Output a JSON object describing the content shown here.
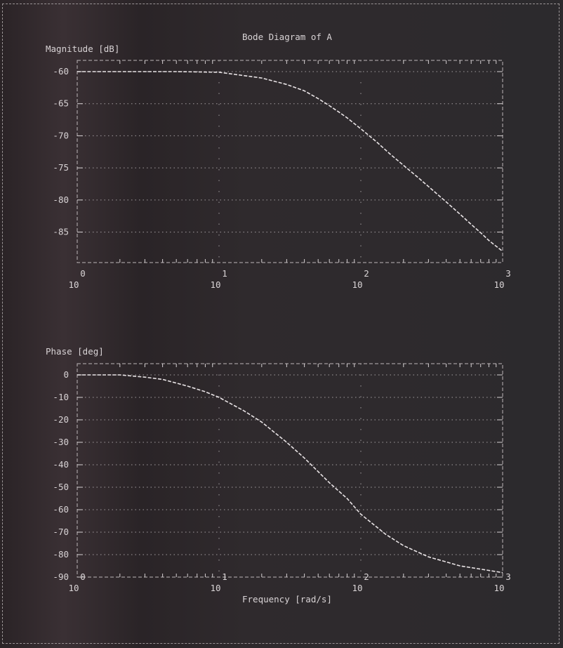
{
  "window": {
    "title": "Bode Diagram of A"
  },
  "chart_data": [
    {
      "type": "line",
      "title": "Bode Diagram of A",
      "ylabel": "Magnitude [dB]",
      "xlabel": "",
      "xscale": "log",
      "xlim": [
        1,
        1000
      ],
      "ylim": [
        -88,
        -60
      ],
      "yticks": [
        -60,
        -65,
        -70,
        -75,
        -80,
        -85
      ],
      "xticks": [
        1,
        10,
        100,
        1000
      ],
      "xtick_labels": [
        {
          "base": "10",
          "exp": "0"
        },
        {
          "base": "10",
          "exp": "1"
        },
        {
          "base": "10",
          "exp": "2"
        },
        {
          "base": "10",
          "exp": "3"
        }
      ],
      "grid": true,
      "series": [
        {
          "x": [
            1,
            2,
            5,
            10,
            20,
            30,
            40,
            50,
            60,
            70,
            80,
            100,
            130,
            160,
            200,
            250,
            300,
            400,
            500,
            600,
            700,
            800,
            1000
          ],
          "values": [
            -60,
            -60,
            -60,
            -60.1,
            -61,
            -62,
            -63,
            -64.2,
            -65.3,
            -66.3,
            -67.2,
            -68.9,
            -71,
            -72.8,
            -74.6,
            -76.4,
            -77.9,
            -80.3,
            -82.2,
            -83.8,
            -85.1,
            -86.3,
            -88
          ]
        }
      ]
    },
    {
      "type": "line",
      "title": "",
      "ylabel": "Phase [deg]",
      "xlabel": "Frequency [rad/s]",
      "xscale": "log",
      "xlim": [
        1,
        1000
      ],
      "ylim": [
        -90,
        0
      ],
      "yticks": [
        0,
        -10,
        -20,
        -30,
        -40,
        -50,
        -60,
        -70,
        -80,
        -90
      ],
      "xticks": [
        1,
        10,
        100,
        1000
      ],
      "xtick_labels": [
        {
          "base": "10",
          "exp": "0"
        },
        {
          "base": "10",
          "exp": "1"
        },
        {
          "base": "10",
          "exp": "2"
        },
        {
          "base": "10",
          "exp": "3"
        }
      ],
      "grid": true,
      "series": [
        {
          "x": [
            1,
            2,
            3,
            4,
            6,
            8,
            10,
            15,
            20,
            30,
            40,
            60,
            80,
            100,
            150,
            200,
            300,
            500,
            1000
          ],
          "values": [
            0,
            0,
            -1,
            -2,
            -5,
            -7.5,
            -10,
            -16,
            -21,
            -30,
            -37,
            -48,
            -55,
            -62,
            -71,
            -76,
            -81,
            -85,
            -88
          ]
        }
      ]
    }
  ]
}
